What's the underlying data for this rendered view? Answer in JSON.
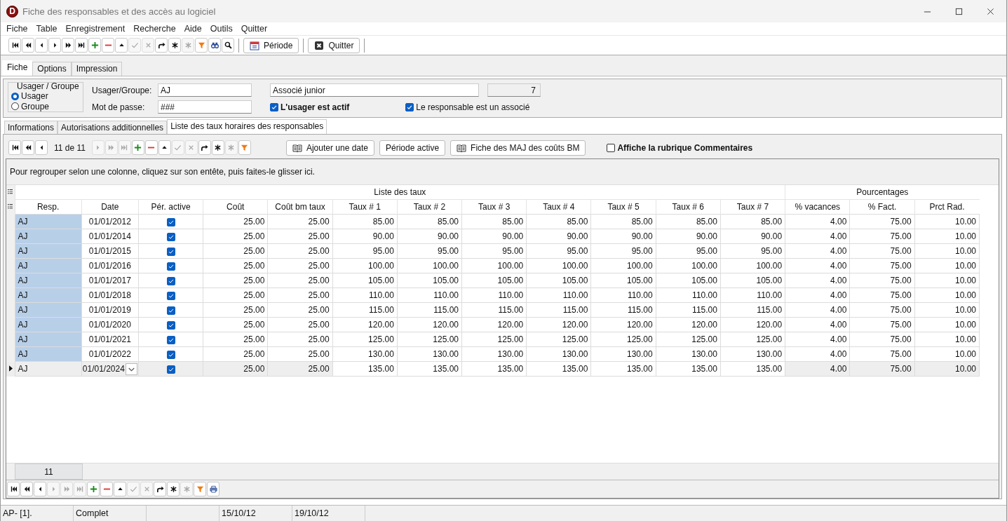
{
  "window": {
    "logo": "D",
    "title": "Fiche des responsables et des accès au logiciel"
  },
  "menu": [
    "Fiche",
    "Table",
    "Enregistrement",
    "Recherche",
    "Aide",
    "Outils",
    "Quitter"
  ],
  "toolbar": {
    "icons": [
      {
        "kind": "first",
        "disabled": false
      },
      {
        "kind": "prev-page",
        "disabled": false
      },
      {
        "kind": "prev",
        "disabled": false
      },
      {
        "kind": "next",
        "disabled": false
      },
      {
        "kind": "next-page",
        "disabled": false
      },
      {
        "kind": "last",
        "disabled": false
      },
      {
        "kind": "add",
        "disabled": false
      },
      {
        "kind": "delete",
        "disabled": false
      },
      {
        "kind": "up",
        "disabled": false
      },
      {
        "kind": "confirm",
        "disabled": true
      },
      {
        "kind": "cancel",
        "disabled": true
      },
      {
        "kind": "redo",
        "disabled": false
      },
      {
        "kind": "asterisk",
        "disabled": false
      },
      {
        "kind": "asterisk",
        "disabled": true
      },
      {
        "kind": "filter",
        "disabled": false
      },
      {
        "kind": "binoculars",
        "disabled": false
      },
      {
        "kind": "search",
        "disabled": false
      }
    ],
    "buttons": [
      {
        "kind": "calendar",
        "label": "Période"
      },
      {
        "kind": "quit",
        "label": "Quitter"
      }
    ]
  },
  "tabs": [
    {
      "label": "Fiche",
      "selected": true
    },
    {
      "label": "Options",
      "selected": false
    },
    {
      "label": "Impression",
      "selected": false
    }
  ],
  "form": {
    "group_title": "Usager / Groupe",
    "radios": [
      {
        "label": "Usager",
        "selected": true
      },
      {
        "label": "Groupe",
        "selected": false
      }
    ],
    "user_label": "Usager/Groupe:",
    "user_value": "AJ",
    "password_label": "Mot de passe:",
    "password_value": "###",
    "description": "Associé junior",
    "number": "7",
    "checks": [
      {
        "label": "L'usager est actif",
        "checked": true
      },
      {
        "label": "Le responsable est un associé",
        "checked": true
      }
    ]
  },
  "subtabs": [
    {
      "label": "Informations",
      "selected": false
    },
    {
      "label": "Autorisations additionnelles",
      "selected": false
    },
    {
      "label": "Liste des taux horaires des responsables",
      "selected": true
    }
  ],
  "subtoolbar": {
    "icons": [
      {
        "kind": "first",
        "disabled": false
      },
      {
        "kind": "prev-page",
        "disabled": false
      },
      {
        "kind": "prev",
        "disabled": false
      },
      {
        "kind": "counter",
        "text": "11 de 11"
      },
      {
        "kind": "next",
        "disabled": true
      },
      {
        "kind": "next-page",
        "disabled": true
      },
      {
        "kind": "last",
        "disabled": true
      },
      {
        "kind": "add",
        "disabled": false
      },
      {
        "kind": "delete",
        "disabled": false
      },
      {
        "kind": "up",
        "disabled": false
      },
      {
        "kind": "confirm",
        "disabled": true
      },
      {
        "kind": "cancel",
        "disabled": true
      },
      {
        "kind": "redo",
        "disabled": false
      },
      {
        "kind": "asterisk",
        "disabled": false
      },
      {
        "kind": "asterisk",
        "disabled": true
      },
      {
        "kind": "filter",
        "disabled": false
      }
    ],
    "buttons": [
      {
        "kind": "book",
        "label": "Ajouter une date"
      },
      {
        "kind": "plain",
        "label": "Période active"
      },
      {
        "kind": "book",
        "label": "Fiche des MAJ des coûts BM"
      }
    ],
    "comment_check": {
      "label": "Affiche la rubrique Commentaires",
      "checked": false
    }
  },
  "grid": {
    "group_hint": "Pour regrouper selon une colonne, cliquez sur son entête, puis faites-le glisser ici.",
    "bands": [
      "Liste des taux",
      "Pourcentages"
    ],
    "columns": [
      "Resp.",
      "Date",
      "Pér. active",
      "Coût",
      "Coût bm taux",
      "Taux # 1",
      "Taux # 2",
      "Taux # 3",
      "Taux # 4",
      "Taux # 5",
      "Taux # 6",
      "Taux # 7",
      "% vacances",
      "% Fact.",
      "Prct Rad."
    ],
    "rows": [
      {
        "current": false,
        "resp": "AJ",
        "date": "01/01/2012",
        "active": true,
        "values": [
          "25.00",
          "25.00",
          "85.00",
          "85.00",
          "85.00",
          "85.00",
          "85.00",
          "85.00",
          "85.00",
          "4.00",
          "75.00",
          "10.00"
        ]
      },
      {
        "current": false,
        "resp": "AJ",
        "date": "01/01/2014",
        "active": true,
        "values": [
          "25.00",
          "25.00",
          "90.00",
          "90.00",
          "90.00",
          "90.00",
          "90.00",
          "90.00",
          "90.00",
          "4.00",
          "75.00",
          "10.00"
        ]
      },
      {
        "current": false,
        "resp": "AJ",
        "date": "01/01/2015",
        "active": true,
        "values": [
          "25.00",
          "25.00",
          "95.00",
          "95.00",
          "95.00",
          "95.00",
          "95.00",
          "95.00",
          "95.00",
          "4.00",
          "75.00",
          "10.00"
        ]
      },
      {
        "current": false,
        "resp": "AJ",
        "date": "01/01/2016",
        "active": true,
        "values": [
          "25.00",
          "25.00",
          "100.00",
          "100.00",
          "100.00",
          "100.00",
          "100.00",
          "100.00",
          "100.00",
          "4.00",
          "75.00",
          "10.00"
        ]
      },
      {
        "current": false,
        "resp": "AJ",
        "date": "01/01/2017",
        "active": true,
        "values": [
          "25.00",
          "25.00",
          "105.00",
          "105.00",
          "105.00",
          "105.00",
          "105.00",
          "105.00",
          "105.00",
          "4.00",
          "75.00",
          "10.00"
        ]
      },
      {
        "current": false,
        "resp": "AJ",
        "date": "01/01/2018",
        "active": true,
        "values": [
          "25.00",
          "25.00",
          "110.00",
          "110.00",
          "110.00",
          "110.00",
          "110.00",
          "110.00",
          "110.00",
          "4.00",
          "75.00",
          "10.00"
        ]
      },
      {
        "current": false,
        "resp": "AJ",
        "date": "01/01/2019",
        "active": true,
        "values": [
          "25.00",
          "25.00",
          "115.00",
          "115.00",
          "115.00",
          "115.00",
          "115.00",
          "115.00",
          "115.00",
          "4.00",
          "75.00",
          "10.00"
        ]
      },
      {
        "current": false,
        "resp": "AJ",
        "date": "01/01/2020",
        "active": true,
        "values": [
          "25.00",
          "25.00",
          "120.00",
          "120.00",
          "120.00",
          "120.00",
          "120.00",
          "120.00",
          "120.00",
          "4.00",
          "75.00",
          "10.00"
        ]
      },
      {
        "current": false,
        "resp": "AJ",
        "date": "01/01/2021",
        "active": true,
        "values": [
          "25.00",
          "25.00",
          "125.00",
          "125.00",
          "125.00",
          "125.00",
          "125.00",
          "125.00",
          "125.00",
          "4.00",
          "75.00",
          "10.00"
        ]
      },
      {
        "current": false,
        "resp": "AJ",
        "date": "01/01/2022",
        "active": true,
        "values": [
          "25.00",
          "25.00",
          "130.00",
          "130.00",
          "130.00",
          "130.00",
          "130.00",
          "130.00",
          "130.00",
          "4.00",
          "75.00",
          "10.00"
        ]
      },
      {
        "current": true,
        "resp": "AJ",
        "date": "01/01/2024",
        "active": true,
        "values": [
          "25.00",
          "25.00",
          "135.00",
          "135.00",
          "135.00",
          "135.00",
          "135.00",
          "135.00",
          "135.00",
          "4.00",
          "75.00",
          "10.00"
        ]
      }
    ],
    "footer_count": "11"
  },
  "bottom_toolbar": {
    "icons": [
      {
        "kind": "first",
        "disabled": false
      },
      {
        "kind": "prev-page",
        "disabled": false
      },
      {
        "kind": "prev",
        "disabled": false
      },
      {
        "kind": "next",
        "disabled": true
      },
      {
        "kind": "next-page",
        "disabled": true
      },
      {
        "kind": "last",
        "disabled": true
      },
      {
        "kind": "add",
        "disabled": false
      },
      {
        "kind": "delete",
        "disabled": false
      },
      {
        "kind": "up",
        "disabled": false
      },
      {
        "kind": "confirm",
        "disabled": true
      },
      {
        "kind": "cancel",
        "disabled": true
      },
      {
        "kind": "redo",
        "disabled": false
      },
      {
        "kind": "asterisk",
        "disabled": false
      },
      {
        "kind": "asterisk",
        "disabled": true
      },
      {
        "kind": "filter",
        "disabled": false
      },
      {
        "kind": "print",
        "disabled": false
      }
    ]
  },
  "status_bar": [
    "AP- [1].",
    "Complet",
    "15/10/12",
    "19/10/12"
  ]
}
